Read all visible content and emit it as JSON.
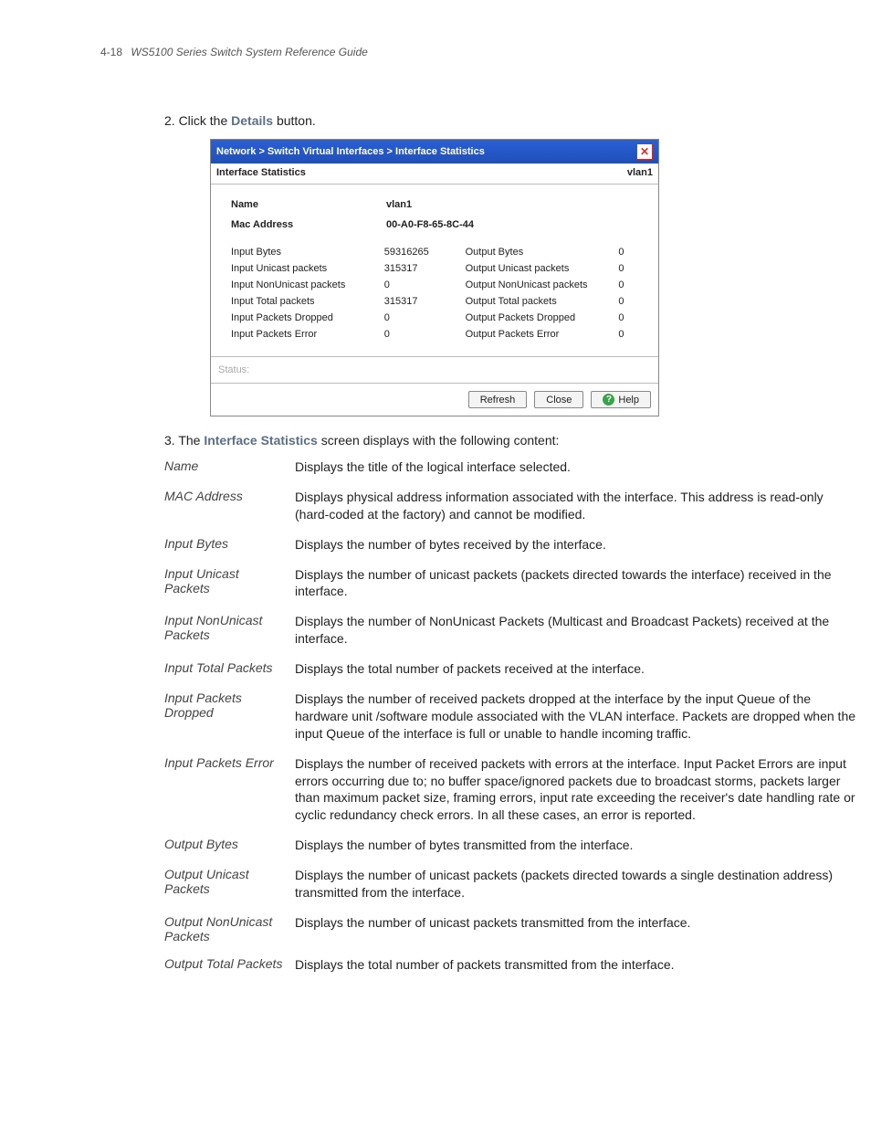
{
  "header": {
    "pagenum": "4-18",
    "title": "WS5100 Series Switch System Reference Guide"
  },
  "step2": {
    "prefix": "2. Click the ",
    "bold": "Details",
    "suffix": " button."
  },
  "step3": {
    "prefix": "3. The ",
    "bold": "Interface Statistics",
    "suffix": " screen displays with the following content:"
  },
  "dialog": {
    "breadcrumb": "Network > Switch Virtual Interfaces > Interface Statistics",
    "subtitle_left": "Interface Statistics",
    "subtitle_right": "vlan1",
    "name_label": "Name",
    "name_value": "vlan1",
    "mac_label": "Mac Address",
    "mac_value": "00-A0-F8-65-8C-44",
    "rows": [
      {
        "l1": "Input Bytes",
        "v1": "59316265",
        "l2": "Output Bytes",
        "v2": "0"
      },
      {
        "l1": "Input Unicast packets",
        "v1": "315317",
        "l2": "Output Unicast packets",
        "v2": "0"
      },
      {
        "l1": "Input NonUnicast packets",
        "v1": "0",
        "l2": "Output NonUnicast packets",
        "v2": "0"
      },
      {
        "l1": "Input Total packets",
        "v1": "315317",
        "l2": "Output Total packets",
        "v2": "0"
      },
      {
        "l1": "Input Packets Dropped",
        "v1": "0",
        "l2": "Output Packets Dropped",
        "v2": "0"
      },
      {
        "l1": "Input Packets Error",
        "v1": "0",
        "l2": "Output Packets Error",
        "v2": "0"
      }
    ],
    "status_label": "Status:",
    "buttons": {
      "refresh": "Refresh",
      "close": "Close",
      "help": "Help"
    }
  },
  "defs": [
    {
      "term": "Name",
      "def": "Displays the title of the logical interface selected."
    },
    {
      "term": "MAC Address",
      "def": "Displays physical address information associated with the interface. This address is read-only (hard-coded at the factory) and cannot be modified."
    },
    {
      "term": "Input Bytes",
      "def": "Displays the number of bytes received by the interface."
    },
    {
      "term": "Input Unicast Packets",
      "def": "Displays the number of unicast packets (packets directed towards the interface) received in the interface."
    },
    {
      "term": "Input NonUnicast Packets",
      "def": "Displays the number of NonUnicast Packets (Multicast and Broadcast Packets) received at the interface."
    },
    {
      "term": "Input Total Packets",
      "def": "Displays the total number of packets received at the interface."
    },
    {
      "term": "Input Packets Dropped",
      "def": "Displays the number of received packets dropped at the interface by the input Queue of the hardware unit /software module associated with the VLAN interface. Packets are dropped when the input Queue of the interface is full or unable to handle incoming traffic."
    },
    {
      "term": "Input Packets Error",
      "def": "Displays the number of received packets with errors at the interface. Input Packet Errors are input errors occurring due to; no buffer space/ignored packets due to broadcast storms, packets larger than maximum packet size, framing errors, input rate exceeding the receiver's date handling rate or cyclic redundancy check errors. In all these cases, an error is reported."
    },
    {
      "term": "Output Bytes",
      "def": "Displays the number of bytes transmitted from the interface."
    },
    {
      "term": "Output Unicast Packets",
      "def": "Displays the number of unicast packets (packets directed towards a single destination address) transmitted from the interface."
    },
    {
      "term": "Output NonUnicast Packets",
      "def": "Displays the number of unicast packets transmitted from the interface."
    },
    {
      "term": "Output Total Packets",
      "def": "Displays the total number of packets transmitted from the interface."
    }
  ]
}
